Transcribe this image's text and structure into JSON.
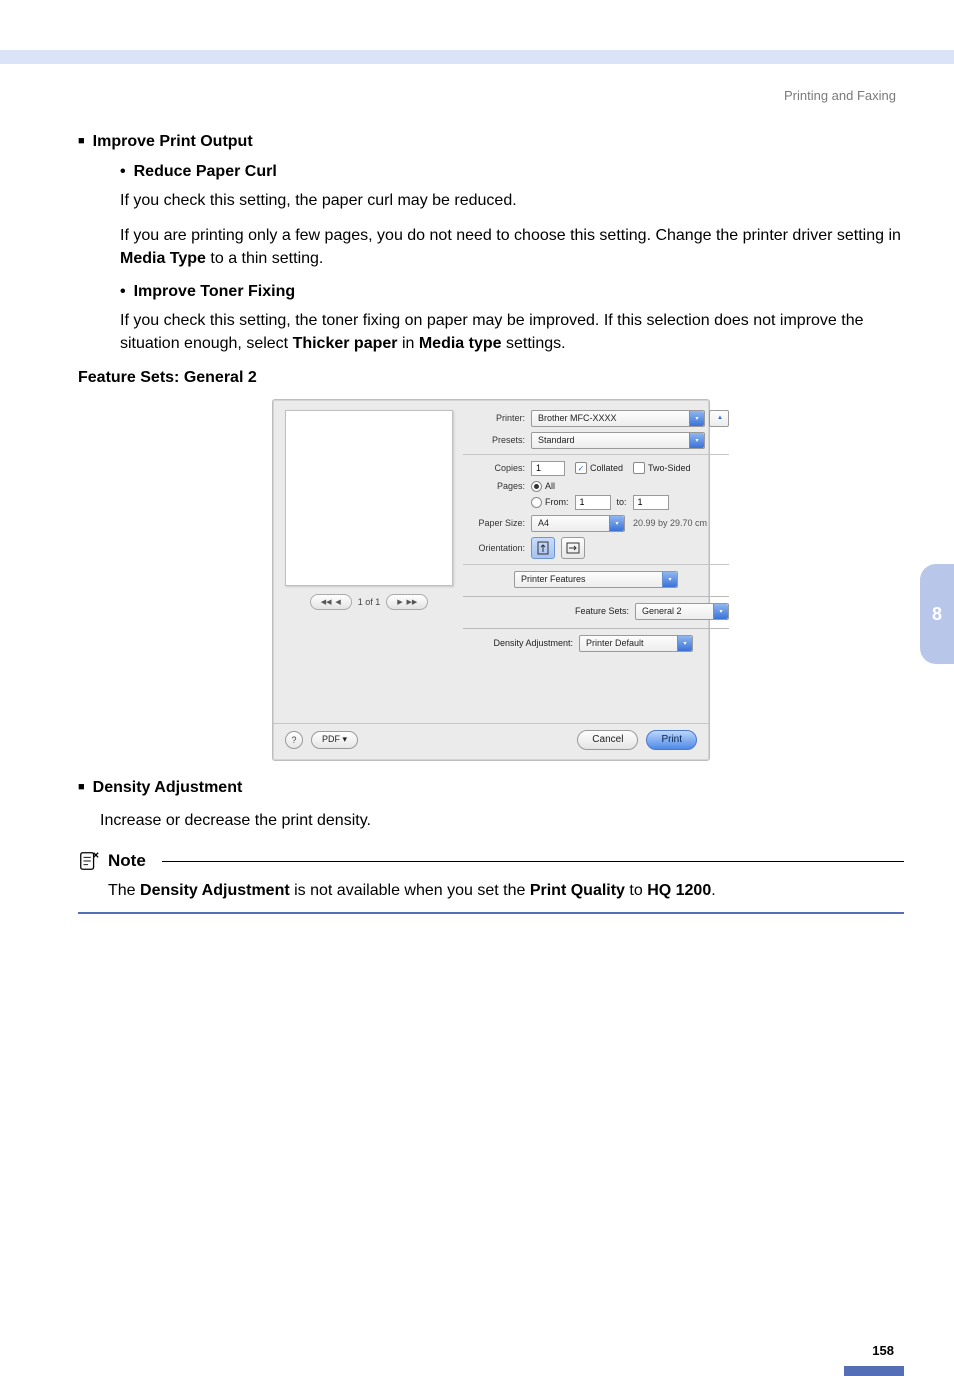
{
  "header": {
    "section": "Printing and Faxing"
  },
  "side_tab": "8",
  "content": {
    "improve_heading": "Improve Print Output",
    "reduce_heading": "Reduce Paper Curl",
    "reduce_p1": "If you check this setting, the paper curl may be reduced.",
    "reduce_p2_a": "If you are printing only a few pages, you do not need to choose this setting. Change the printer driver setting in ",
    "reduce_p2_bold": "Media Type",
    "reduce_p2_b": " to a thin setting.",
    "toner_heading": "Improve Toner Fixing",
    "toner_p_a": "If you check this setting, the toner fixing on paper may be improved. If this selection does not improve the situation enough, select ",
    "toner_p_bold1": "Thicker paper",
    "toner_p_mid": " in ",
    "toner_p_bold2": "Media type",
    "toner_p_b": " settings.",
    "feature_sets": "Feature Sets: General 2",
    "density_heading": "Density Adjustment",
    "density_body": "Increase or decrease the print density."
  },
  "note": {
    "title": "Note",
    "body_a": "The ",
    "body_b1": "Density Adjustment",
    "body_mid": " is not available when you set the ",
    "body_b2": "Print Quality",
    "body_to": " to ",
    "body_b3": "HQ 1200",
    "body_end": "."
  },
  "dialog": {
    "labels": {
      "printer": "Printer:",
      "presets": "Presets:",
      "copies": "Copies:",
      "pages": "Pages:",
      "paper_size": "Paper Size:",
      "orientation": "Orientation:",
      "feature_sets": "Feature Sets:",
      "density_adjustment": "Density Adjustment:"
    },
    "values": {
      "printer": "Brother MFC-XXXX",
      "presets": "Standard",
      "copies": "1",
      "collated": "Collated",
      "two_sided": "Two-Sided",
      "all": "All",
      "from": "From:",
      "from_val": "1",
      "to": "to:",
      "to_val": "1",
      "paper_size": "A4",
      "paper_dim": "20.99 by 29.70 cm",
      "panel": "Printer Features",
      "feature_sets": "General 2",
      "density": "Printer Default"
    },
    "pager": "1 of 1",
    "footer": {
      "help": "?",
      "pdf": "PDF ▾",
      "cancel": "Cancel",
      "print": "Print"
    }
  },
  "page_number": "158"
}
